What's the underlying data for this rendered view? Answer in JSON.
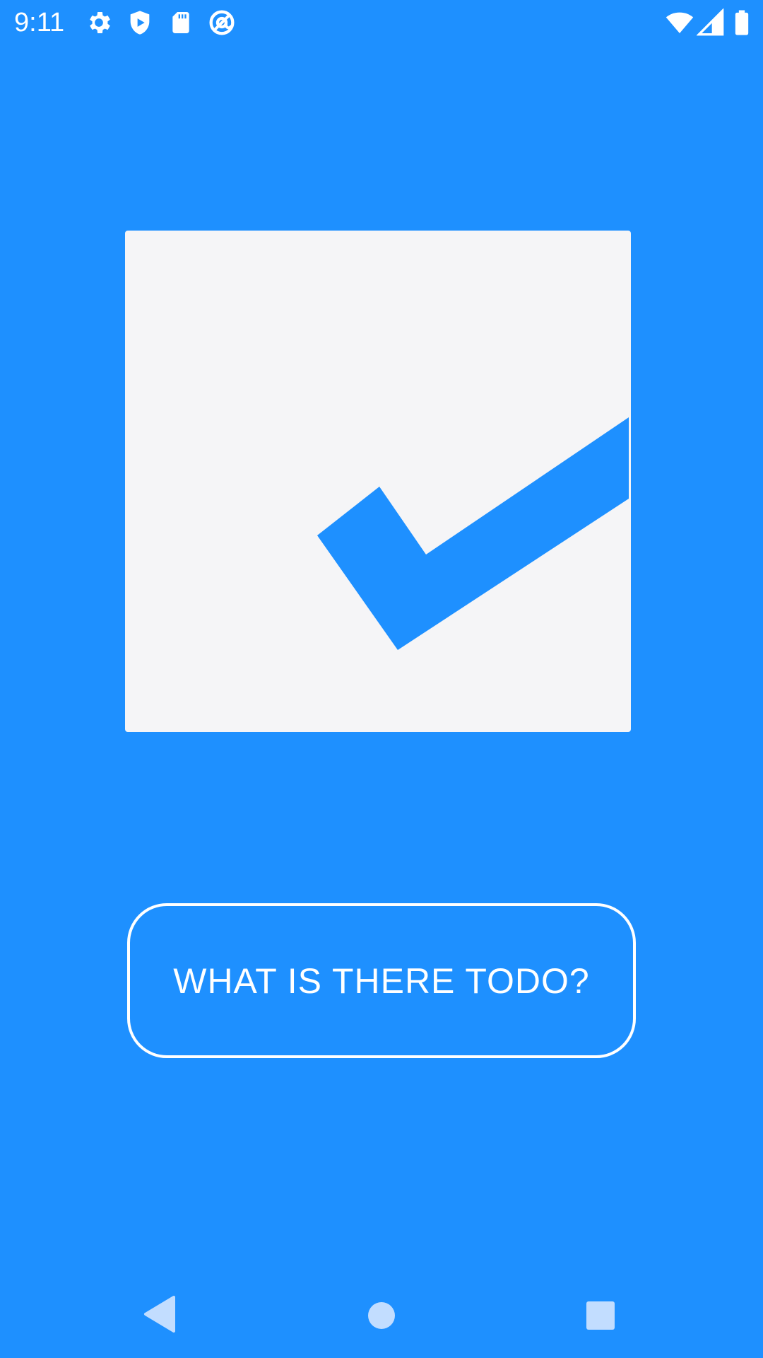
{
  "status_bar": {
    "time": "9:11",
    "left_icons": [
      "gear-icon",
      "shield-play-icon",
      "sd-card-icon",
      "at-sign-icon"
    ],
    "right_icons": [
      "wifi-icon",
      "cellular-signal-icon",
      "battery-icon"
    ]
  },
  "logo": {
    "icon": "checkmark-icon",
    "card_color": "#f5f5f7",
    "check_color": "#1e90ff"
  },
  "cta_button": {
    "label": "WHAT IS THERE TODO?"
  },
  "nav_bar": {
    "buttons": [
      "back-icon",
      "home-icon",
      "recents-icon"
    ]
  },
  "colors": {
    "background": "#1e90ff",
    "foreground": "#ffffff"
  }
}
